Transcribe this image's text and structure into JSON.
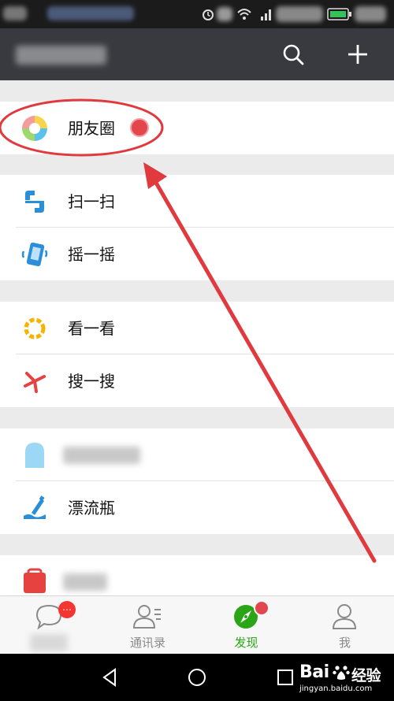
{
  "main": {
    "groups": [
      {
        "items": [
          {
            "label": "朋友圈",
            "icon": "moments-icon"
          }
        ]
      },
      {
        "items": [
          {
            "label": "扫一扫",
            "icon": "scan-icon"
          },
          {
            "label": "摇一摇",
            "icon": "shake-icon"
          }
        ]
      },
      {
        "items": [
          {
            "label": "看一看",
            "icon": "top-stories-icon"
          },
          {
            "label": "搜一搜",
            "icon": "search-feature-icon"
          }
        ]
      },
      {
        "items": [
          {
            "label": "",
            "icon": "nearby-icon"
          },
          {
            "label": "漂流瓶",
            "icon": "drift-bottle-icon"
          }
        ]
      },
      {
        "items": [
          {
            "label": "",
            "icon": "shopping-icon"
          }
        ]
      }
    ]
  },
  "tabbar": {
    "tabs": [
      {
        "label": "",
        "icon": "chats-icon",
        "badge": "…"
      },
      {
        "label": "通讯录",
        "icon": "contacts-icon"
      },
      {
        "label": "发现",
        "icon": "discover-icon",
        "active": true
      },
      {
        "label": "我",
        "icon": "me-icon"
      }
    ]
  },
  "watermark": {
    "brand": "Bai",
    "brand_suffix": "经验",
    "url": "jingyan.baidu.com"
  },
  "colors": {
    "title_bar": "#393a3f",
    "accent_green": "#2aa515",
    "badge_red": "#f43530",
    "annotation_red": "#e03a3e",
    "page_bg": "#ebebeb"
  }
}
